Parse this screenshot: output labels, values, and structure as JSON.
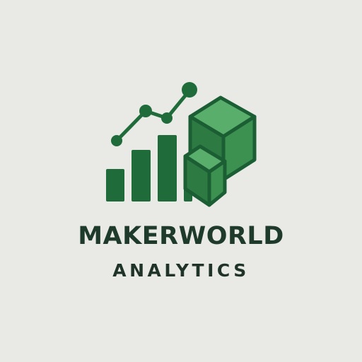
{
  "brand": {
    "name": "MAKERWORLD",
    "tagline": "ANALYTICS"
  },
  "logo": {
    "icon_name": "bar-chart-with-trend-line-and-cubes-icon",
    "colors": {
      "background": "#e9e9e6",
      "bar": "#1f6b3a",
      "trend_line": "#1f6b3a",
      "cube_face_top": "#5aae6c",
      "cube_face_front": "#3d9150",
      "cube_face_side": "#2d7a42",
      "cube_outline": "#1b5e34",
      "wordmark_primary": "#1e3a2a",
      "wordmark_secondary": "#1f3328"
    }
  }
}
